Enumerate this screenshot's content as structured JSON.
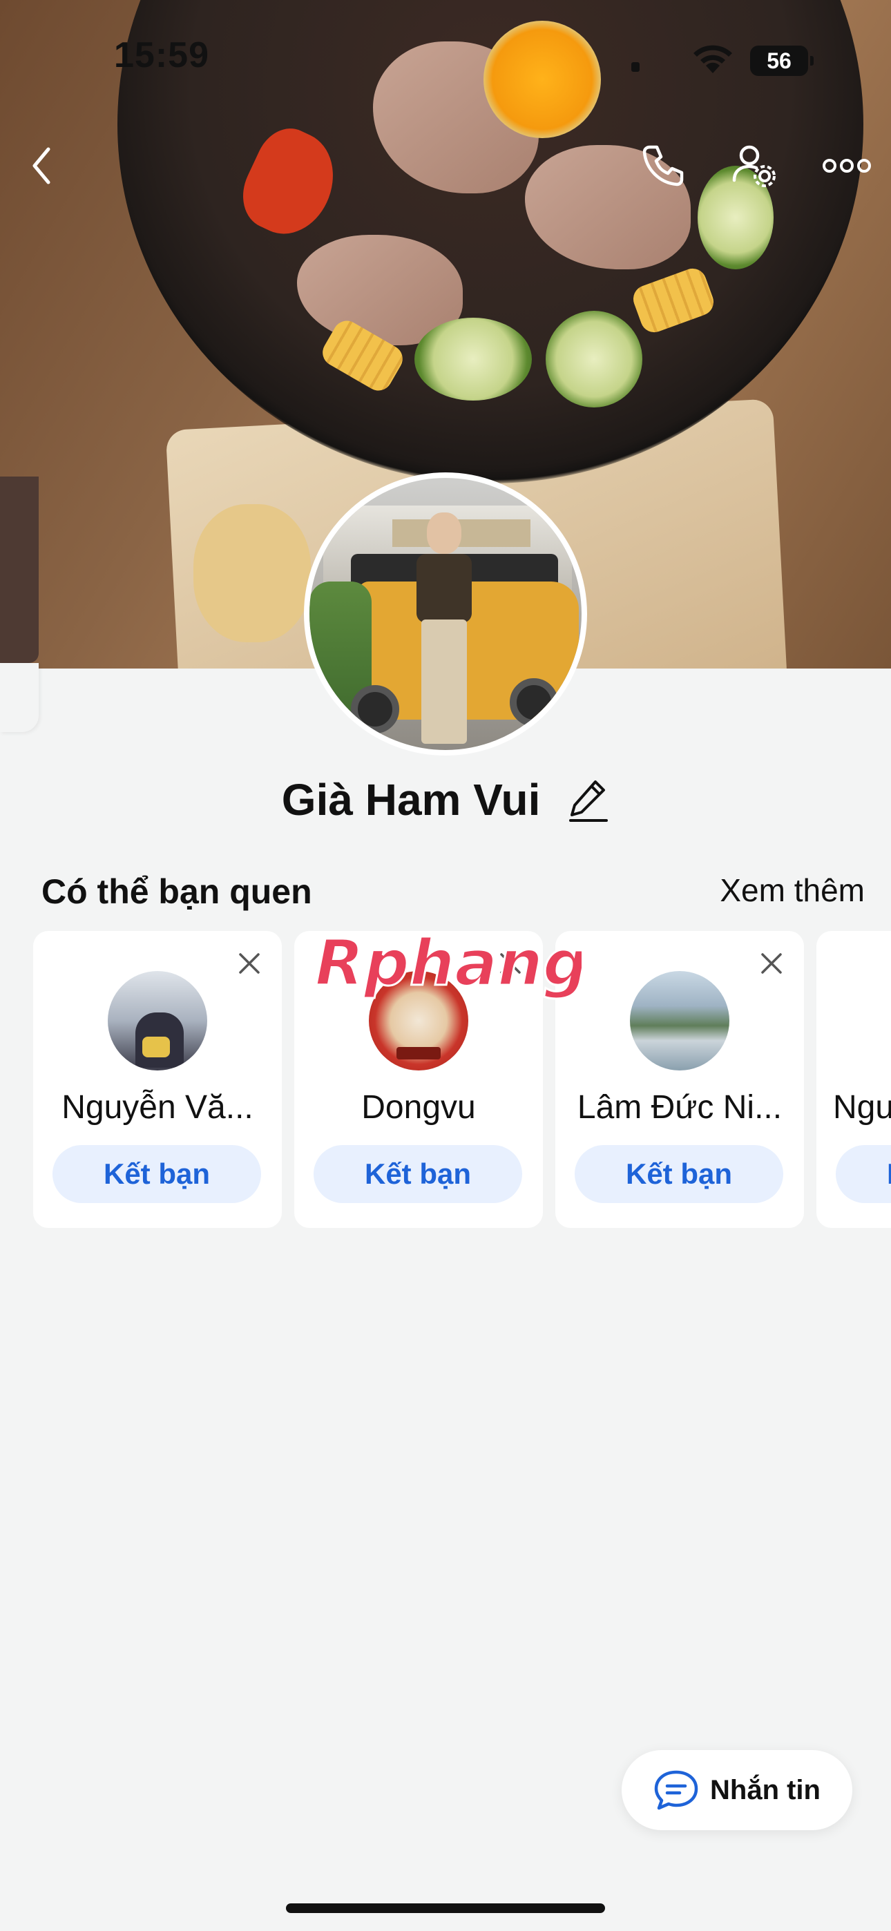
{
  "status_bar": {
    "time": "15:59",
    "battery": "56"
  },
  "header": {
    "back_icon": "chevron-left-icon",
    "call_icon": "phone-icon",
    "settings_icon": "user-settings-icon",
    "more_icon": "more-dots-icon"
  },
  "profile": {
    "name": "Già Ham Vui",
    "edit_icon": "pencil-icon"
  },
  "suggestions": {
    "title": "Có thể bạn quen",
    "see_more": "Xem thêm",
    "items": [
      {
        "name": "Nguyễn Vă...",
        "action": "Kết bạn"
      },
      {
        "name": "Dongvu",
        "action": "Kết bạn"
      },
      {
        "name": "Lâm Đức Ni...",
        "action": "Kết bạn"
      },
      {
        "name": "Ngu",
        "action": "Kết bạn"
      }
    ]
  },
  "watermark": "Rphang",
  "message_button": {
    "label": "Nhắn tin",
    "icon": "chat-bubble-icon"
  },
  "colors": {
    "accent": "#1e63d8",
    "button_bg": "#e8f0fe",
    "page_bg": "#f3f4f4"
  }
}
